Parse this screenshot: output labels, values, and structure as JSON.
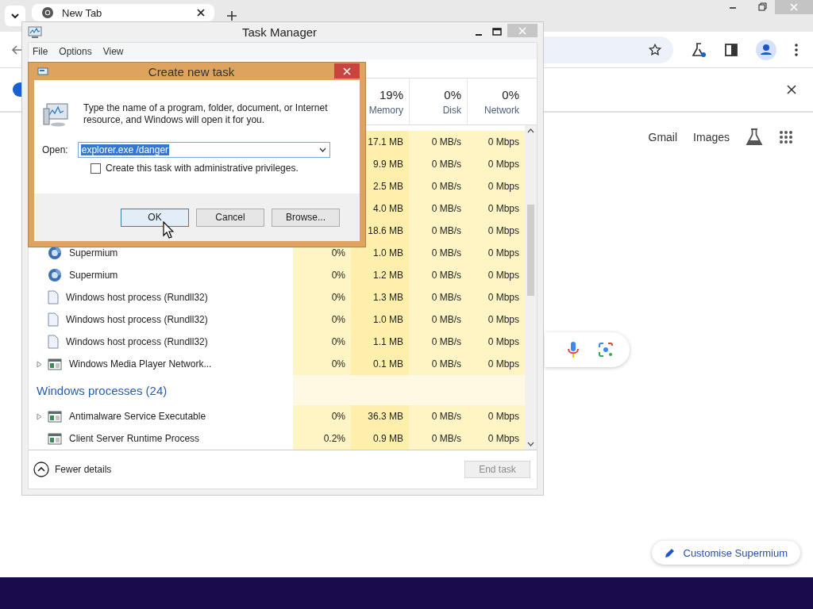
{
  "browser": {
    "tab": {
      "title": "New Tab",
      "selected": true
    },
    "links": [
      "Gmail",
      "Images"
    ],
    "customise_button": "Customise Supermium"
  },
  "task_manager": {
    "title": "Task Manager",
    "menu": [
      "File",
      "Options",
      "View"
    ],
    "columns": [
      {
        "percent": "19%",
        "label": "Memory"
      },
      {
        "percent": "0%",
        "label": "Disk"
      },
      {
        "percent": "0%",
        "label": "Network"
      }
    ],
    "rows": [
      {
        "memory": "17.1 MB",
        "disk": "0 MB/s",
        "network": "0 Mbps"
      },
      {
        "memory": "9.9 MB",
        "disk": "0 MB/s",
        "network": "0 Mbps"
      },
      {
        "memory": "2.5 MB",
        "disk": "0 MB/s",
        "network": "0 Mbps"
      },
      {
        "memory": "4.0 MB",
        "disk": "0 MB/s",
        "network": "0 Mbps"
      },
      {
        "memory": "18.6 MB",
        "disk": "0 MB/s",
        "network": "0 Mbps"
      },
      {
        "kind": "browser",
        "expander": false,
        "name": "Supermium",
        "cpu": "0%",
        "memory": "1.0 MB",
        "disk": "0 MB/s",
        "network": "0 Mbps"
      },
      {
        "kind": "browser",
        "expander": false,
        "name": "Supermium",
        "cpu": "0%",
        "memory": "1.2 MB",
        "disk": "0 MB/s",
        "network": "0 Mbps"
      },
      {
        "kind": "document",
        "expander": false,
        "name": "Windows host process (Rundll32)",
        "cpu": "0%",
        "memory": "1.3 MB",
        "disk": "0 MB/s",
        "network": "0 Mbps"
      },
      {
        "kind": "document",
        "expander": false,
        "name": "Windows host process (Rundll32)",
        "cpu": "0%",
        "memory": "1.0 MB",
        "disk": "0 MB/s",
        "network": "0 Mbps"
      },
      {
        "kind": "document",
        "expander": false,
        "name": "Windows host process (Rundll32)",
        "cpu": "0%",
        "memory": "1.1 MB",
        "disk": "0 MB/s",
        "network": "0 Mbps"
      },
      {
        "kind": "app",
        "expander": true,
        "name": "Windows Media Player Network...",
        "cpu": "0%",
        "memory": "0.1 MB",
        "disk": "0 MB/s",
        "network": "0 Mbps"
      },
      {
        "kind": "group",
        "name": "Windows processes (24)"
      },
      {
        "kind": "app",
        "expander": true,
        "name": "Antimalware Service Executable",
        "cpu": "0%",
        "memory": "36.3 MB",
        "disk": "0 MB/s",
        "network": "0 Mbps"
      },
      {
        "kind": "app",
        "expander": false,
        "name": "Client Server Runtime Process",
        "cpu": "0.2%",
        "memory": "0.9 MB",
        "disk": "0 MB/s",
        "network": "0 Mbps"
      }
    ],
    "fewer_details": "Fewer details",
    "end_task": {
      "label": "End task",
      "disabled": true
    }
  },
  "dialog": {
    "title": "Create new task",
    "message": "Type the name of a program, folder, document, or Internet resource, and Windows will open it for you.",
    "open_label": "Open:",
    "open_value": "explorer.exe /danger",
    "admin": {
      "label": "Create this task with administrative privileges.",
      "checked": false
    },
    "buttons": [
      "OK",
      "Cancel",
      "Browse..."
    ]
  }
}
